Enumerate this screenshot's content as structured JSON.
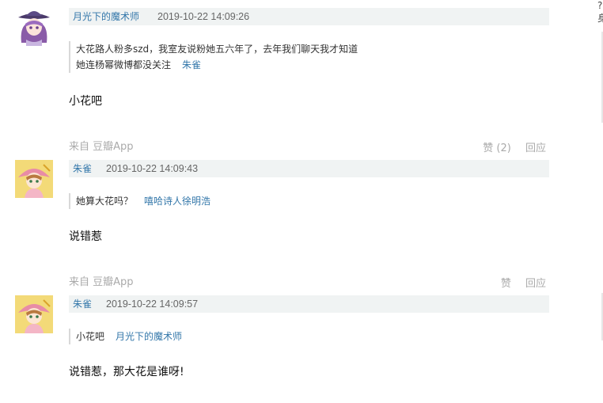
{
  "comments": [
    {
      "author": "月光下的魔术师",
      "time": "2019-10-22 14:09:26",
      "quote_lines": [
        "大花路人粉多szd，我室友说粉她五六年了，去年我们聊天我才知道",
        "她连杨幂微博都没关注"
      ],
      "quote_author": "朱雀",
      "content": "小花吧",
      "source": "来自 豆瓣App",
      "like_label": "赞 (2)",
      "reply_label": "回应"
    },
    {
      "author": "朱雀",
      "time": "2019-10-22 14:09:43",
      "quote_lines": [
        "她算大花吗？"
      ],
      "quote_author": "嘻哈诗人徐明浩",
      "content": "说错惹",
      "source": "来自 豆瓣App",
      "like_label": "赞",
      "reply_label": "回应"
    },
    {
      "author": "朱雀",
      "time": "2019-10-22 14:09:57",
      "quote_lines": [
        "小花吧"
      ],
      "quote_author": "月光下的魔术师",
      "content": "说错惹，那大花是谁呀!"
    }
  ],
  "edge": {
    "glyph_1": "?",
    "glyph_2": "身"
  },
  "colors": {
    "link": "#3377aa",
    "header_bg": "#f0f3f3",
    "meta": "#aaaaaa"
  }
}
